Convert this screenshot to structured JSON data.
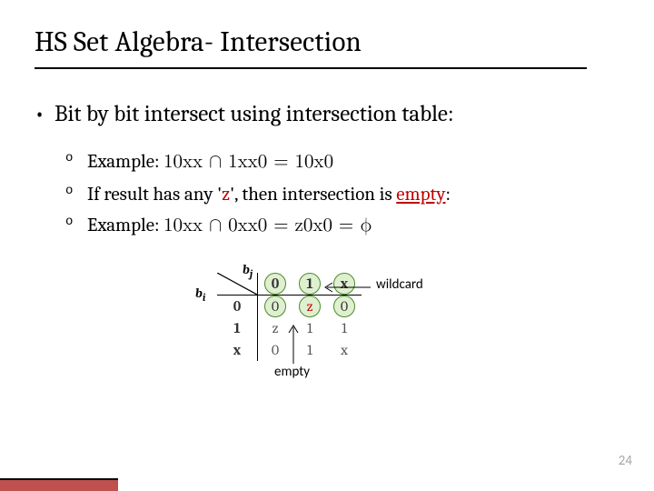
{
  "title": "HS Set Algebra- Intersection",
  "bullet1": "Bit by bit intersect using intersection table:",
  "sub": {
    "ex1_label": "Example: ",
    "ex1_formula": "10xx ∩ 1xx0 = 10x0",
    "line2_a": "If result has any '",
    "line2_z": "z",
    "line2_b": "', then intersection is ",
    "line2_empty": "empty",
    "line2_c": ":",
    "ex2_label": "Example: ",
    "ex2_formula": "10xx ∩ 0xx0 = z0x0 = ϕ"
  },
  "table": {
    "bi": "b",
    "bi_sub_i": "i",
    "bj": "b",
    "bj_sub_j": "j",
    "col0": "0",
    "col1": "1",
    "colx": "x",
    "row0": "0",
    "row1": "1",
    "rowx": "x",
    "c00": "0",
    "c01": "z",
    "c0x": "0",
    "c10": "z",
    "c11": "1",
    "c1x": "1",
    "cx0": "0",
    "cx1": "1",
    "cxx": "x"
  },
  "callouts": {
    "wildcard": "wildcard",
    "empty": "empty"
  },
  "pagenum": "24"
}
